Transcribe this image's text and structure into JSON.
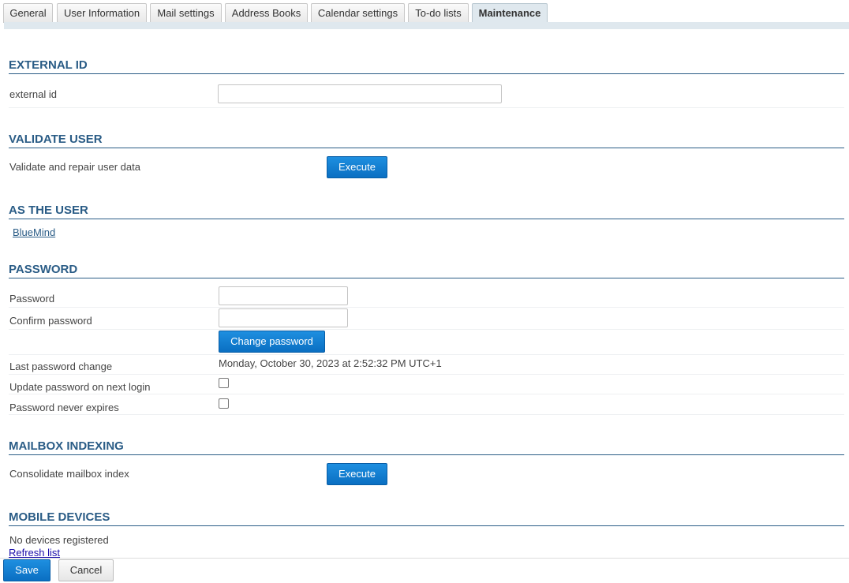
{
  "tabs": [
    {
      "label": "General"
    },
    {
      "label": "User Information"
    },
    {
      "label": "Mail settings"
    },
    {
      "label": "Address Books"
    },
    {
      "label": "Calendar settings"
    },
    {
      "label": "To-do lists"
    },
    {
      "label": "Maintenance",
      "active": true
    }
  ],
  "external_id": {
    "title": "EXTERNAL ID",
    "label": "external id",
    "value": ""
  },
  "validate_user": {
    "title": "VALIDATE USER",
    "label": "Validate and repair user data",
    "button": "Execute"
  },
  "as_user": {
    "title": "AS THE USER",
    "link": "BlueMind"
  },
  "password": {
    "title": "PASSWORD",
    "password_label": "Password",
    "confirm_label": "Confirm password",
    "change_button": "Change password",
    "last_change_label": "Last password change",
    "last_change_value": "Monday, October 30, 2023 at 2:52:32 PM UTC+1",
    "update_next_login_label": "Update password on next login",
    "update_next_login_checked": false,
    "never_expires_label": "Password never expires",
    "never_expires_checked": false
  },
  "mailbox_indexing": {
    "title": "MAILBOX INDEXING",
    "label": "Consolidate mailbox index",
    "button": "Execute"
  },
  "mobile_devices": {
    "title": "MOBILE DEVICES",
    "status": "No devices registered",
    "refresh_link": "Refresh list"
  },
  "footer": {
    "save_label": "Save",
    "cancel_label": "Cancel"
  },
  "colors": {
    "accent": "#2a5c86",
    "button_blue": "#0a6fc2",
    "tab_active_bg": "#dfe8ee"
  }
}
